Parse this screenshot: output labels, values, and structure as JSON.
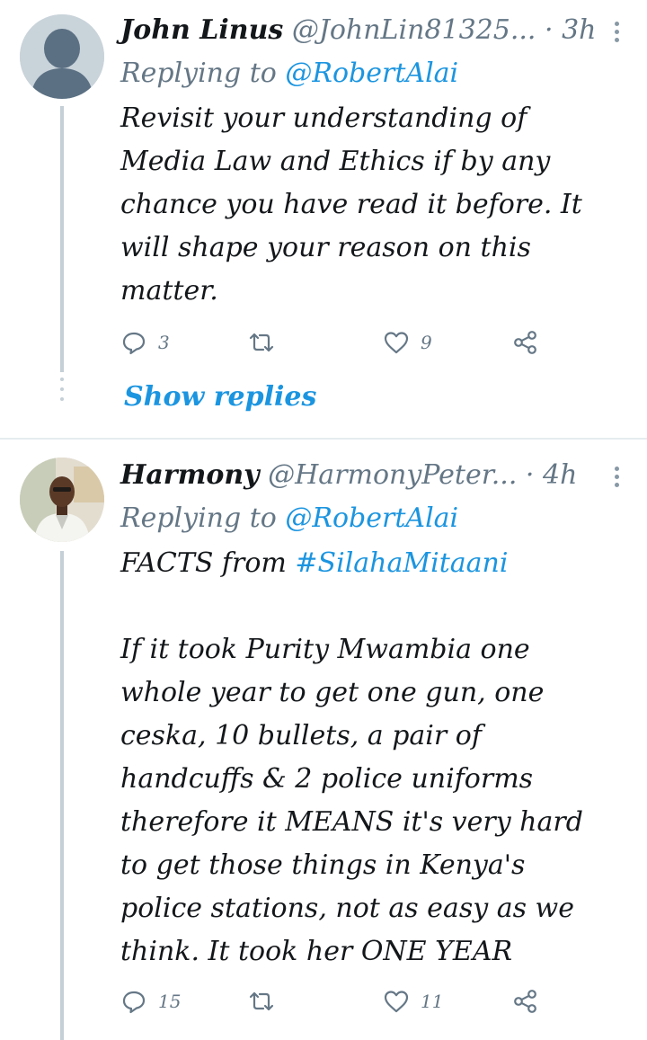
{
  "tweets": [
    {
      "name": "John Linus",
      "handle": "@JohnLin81325...",
      "separator": " · ",
      "time": "3h",
      "replying_prefix": "Replying to ",
      "replying_to": "@RobertAlai",
      "body_lines": [
        "Revisit your understanding of",
        "Media Law and Ethics if by any",
        "chance you have read it before. It",
        "will shape your reason on this",
        "matter."
      ],
      "reply_count": "3",
      "retweet_count": "",
      "like_count": "9",
      "show_replies": "Show replies"
    },
    {
      "name": "Harmony",
      "handle": "@HarmonyPeter...",
      "separator": " · ",
      "time": "4h",
      "replying_prefix": "Replying to ",
      "replying_to": "@RobertAlai",
      "body_first_prefix": "FACTS  from ",
      "body_hashtag": "#SilahaMitaani",
      "body_lines": [
        "If it took Purity Mwambia one",
        "whole year to get one gun, one",
        "ceska, 10 bullets, a pair of",
        "handcuffs & 2 police uniforms",
        "therefore it MEANS it's very hard",
        "to get those things in Kenya's",
        "police stations, not as easy as we",
        "think. It took her ONE YEAR"
      ],
      "reply_count": "15",
      "retweet_count": "",
      "like_count": "11"
    }
  ],
  "icons": {
    "reply": "reply-icon",
    "retweet": "retweet-icon",
    "like": "heart-icon",
    "share": "share-icon",
    "more": "more-vertical-icon"
  },
  "colors": {
    "link": "#1b95e0",
    "secondary_text": "#657786",
    "icon": "#657786",
    "thread_line": "#c4cfd6"
  }
}
